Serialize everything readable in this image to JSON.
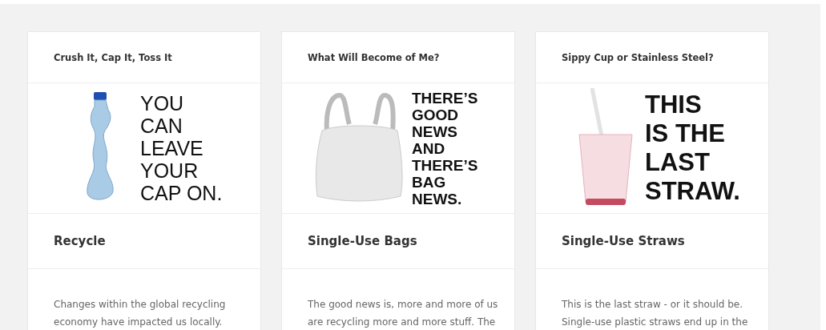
{
  "cards": [
    {
      "kind": "bottle",
      "header": "Crush It, Cap It, Toss It",
      "headline": [
        "YOU",
        "CAN",
        "LEAVE",
        "YOUR",
        "CAP ON."
      ],
      "title": "Recycle",
      "body": [
        "Changes within the global recycling",
        "economy have impacted us locally."
      ]
    },
    {
      "kind": "bag",
      "header": "What Will Become of Me?",
      "headline": [
        "THERE’S",
        "GOOD",
        "NEWS",
        "AND",
        "THERE’S",
        "BAG",
        "NEWS."
      ],
      "title": "Single-Use Bags",
      "body": [
        "The good news is, more and more of us",
        "are recycling more and more stuff. The"
      ]
    },
    {
      "kind": "cup",
      "header": "Sippy Cup or Stainless Steel?",
      "headline": [
        "THIS",
        "IS THE",
        "LAST",
        "STRAW."
      ],
      "title": "Single-Use Straws",
      "body": [
        "This is the last straw - or it should be.",
        "Single-use plastic straws end up in the"
      ]
    }
  ]
}
